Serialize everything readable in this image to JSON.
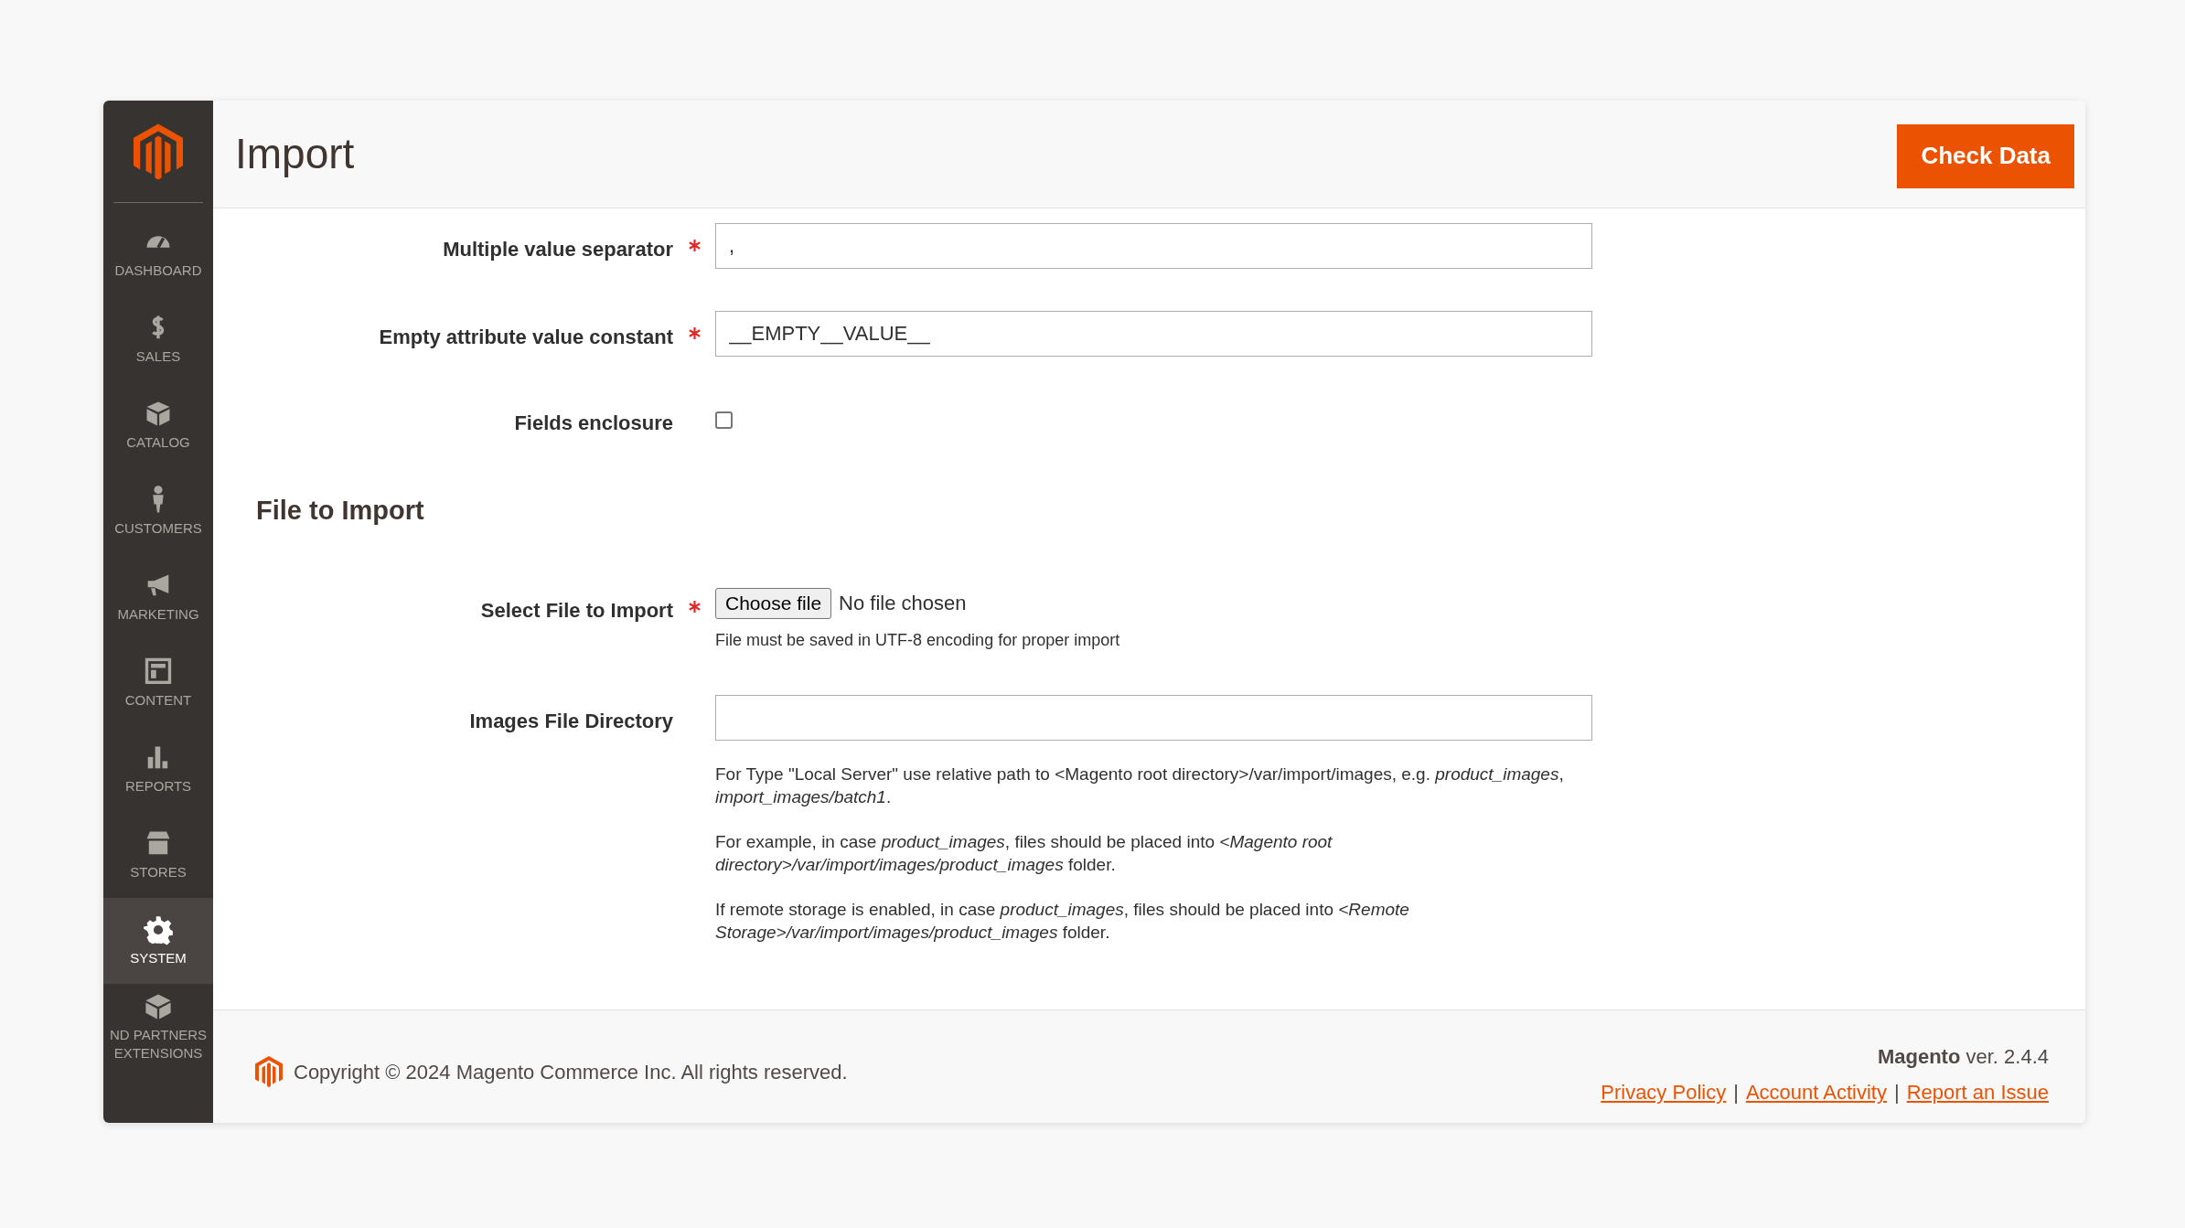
{
  "sidebar": {
    "items": [
      {
        "label": "DASHBOARD",
        "selected": false
      },
      {
        "label": "SALES",
        "selected": false
      },
      {
        "label": "CATALOG",
        "selected": false
      },
      {
        "label": "CUSTOMERS",
        "selected": false
      },
      {
        "label": "MARKETING",
        "selected": false
      },
      {
        "label": "CONTENT",
        "selected": false
      },
      {
        "label": "REPORTS",
        "selected": false
      },
      {
        "label": "STORES",
        "selected": false
      },
      {
        "label": "SYSTEM",
        "selected": true
      },
      {
        "label": "ND PARTNERS\nEXTENSIONS",
        "selected": false
      }
    ]
  },
  "header": {
    "title": "Import",
    "button": "Check Data"
  },
  "form": [
    {
      "kind": "text",
      "label": "Multiple value separator",
      "required": true,
      "value": ","
    },
    {
      "kind": "text",
      "label": "Empty attribute value constant",
      "required": true,
      "value": "__EMPTY__VALUE__"
    },
    {
      "kind": "checkbox",
      "label": "Fields enclosure",
      "required": false,
      "checked": false
    },
    {
      "kind": "heading",
      "label": "File to Import"
    },
    {
      "kind": "file",
      "label": "Select File to Import",
      "required": true,
      "button": "Choose file",
      "status": "No file chosen",
      "note": "File must be saved in UTF-8 encoding for proper import"
    },
    {
      "kind": "text",
      "label": "Images File Directory",
      "required": false,
      "notes": [
        "For Type \"Local Server\" use relative path to <Magento root directory>/var/import/images, e.g. *product_images*,\n*import_images/batch1*.",
        "For example, in case *product_images*, files should be placed into *<Magento root*\n*directory>/var/import/images/product_images* folder.",
        "If remote storage is enabled, in case *product_images*, files should be placed into *<Remote*\n*Storage>/var/import/images/product_images* folder."
      ]
    }
  ],
  "footer": {
    "copyright": "Copyright © 2024 Magento Commerce Inc. All rights reserved.",
    "version": "**Magento** ver. 2.4.4",
    "links": [
      "Privacy Policy",
      "Account Activity",
      "Report an Issue"
    ],
    "separators": [
      "|",
      "|"
    ]
  }
}
